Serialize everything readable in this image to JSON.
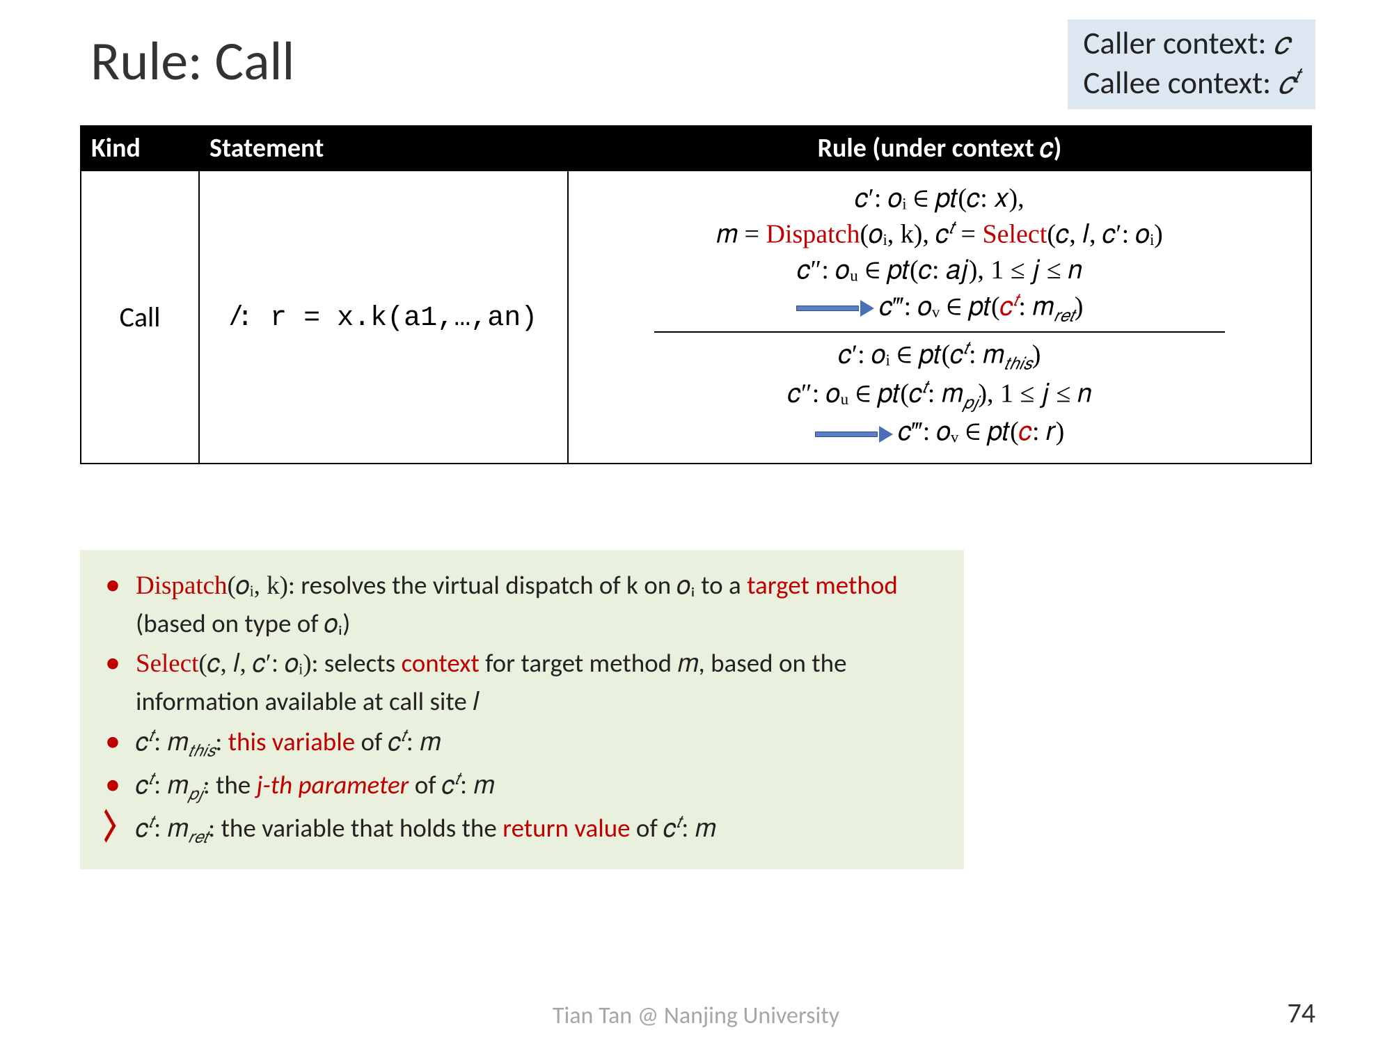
{
  "title": "Rule: Call",
  "contextBox": {
    "line1_label": "Caller context: ",
    "line1_sym": "𝑐",
    "line2_label": "Callee context: ",
    "line2_sym": "𝑐",
    "line2_sup": "𝑡"
  },
  "table": {
    "headers": {
      "kind": "Kind",
      "statement": "Statement",
      "rule": "Rule (under context 𝑐)"
    },
    "row": {
      "kind": "Call",
      "stmt_l": "𝑙",
      "stmt_rest": ": r = x.k(a1,…,an)",
      "rule": {
        "l1": "𝑐′: 𝑜ᵢ ∈ 𝑝𝑡(𝑐: 𝑥),",
        "l2a": "𝑚 = ",
        "l2_dispatch": "Dispatch",
        "l2b": "(𝑜ᵢ, k), 𝑐",
        "l2_sup1": "𝑡",
        "l2c": " = ",
        "l2_select": "Select",
        "l2d": "(𝑐, 𝑙, 𝑐′: 𝑜ᵢ)",
        "l3": "𝑐″: 𝑜ᵤ ∈ 𝑝𝑡(𝑐: 𝑎𝑗), 1 ≤ 𝑗 ≤ 𝑛",
        "l4a": "𝑐‴: 𝑜ᵥ ∈ 𝑝𝑡(",
        "l4_ct": "𝑐",
        "l4_sup": "𝑡",
        "l4b": ": 𝑚",
        "l4_sub": "𝑟𝑒𝑡",
        "l4c": ")",
        "l5a": "𝑐′: 𝑜ᵢ ∈ 𝑝𝑡(𝑐",
        "l5_sup": "𝑡",
        "l5b": ": 𝑚",
        "l5_sub": "𝑡ℎ𝑖𝑠",
        "l5c": ")",
        "l6a": "𝑐″: 𝑜ᵤ ∈ 𝑝𝑡(𝑐",
        "l6_sup": "𝑡",
        "l6b": ": 𝑚",
        "l6_sub": "𝑝𝑗",
        "l6c": "), 1 ≤ 𝑗 ≤ 𝑛",
        "l7a": "𝑐‴: 𝑜ᵥ ∈ 𝑝𝑡(",
        "l7_c": "𝑐",
        "l7b": ": 𝑟)"
      }
    }
  },
  "notes": {
    "i1_a": "Dispatch",
    "i1_b": "(𝑜ᵢ, k)",
    "i1_c": ": resolves the virtual dispatch of k on 𝑜ᵢ to a ",
    "i1_d": "target method",
    "i1_e": " (based on type of 𝑜ᵢ)",
    "i2_a": "Select",
    "i2_b": "(𝑐, 𝑙, 𝑐′: 𝑜ᵢ)",
    "i2_c": ": selects ",
    "i2_d": "context",
    "i2_e": " for target method 𝑚, based on the information available at call site 𝑙",
    "i3_a": "𝑐",
    "i3_sup": "𝑡",
    "i3_b": ": 𝑚",
    "i3_sub": "𝑡ℎ𝑖𝑠",
    "i3_c": ": ",
    "i3_d": "this variable",
    "i3_e": " of 𝑐",
    "i3_sup2": "𝑡",
    "i3_f": ": 𝑚",
    "i4_a": "𝑐",
    "i4_sup": "𝑡",
    "i4_b": ": 𝑚",
    "i4_sub": "𝑝𝑗",
    "i4_c": ": the ",
    "i4_d": "j-th parameter",
    "i4_e": " of 𝑐",
    "i4_sup2": "𝑡",
    "i4_f": ": 𝑚",
    "i5_a": "𝑐",
    "i5_sup": "𝑡",
    "i5_b": ": 𝑚",
    "i5_sub": "𝑟𝑒𝑡",
    "i5_c": ": the variable that holds the ",
    "i5_d": "return value",
    "i5_e": " of 𝑐",
    "i5_sup2": "𝑡",
    "i5_f": ": 𝑚"
  },
  "footer": "Tian Tan @ Nanjing University",
  "pagenum": "74"
}
